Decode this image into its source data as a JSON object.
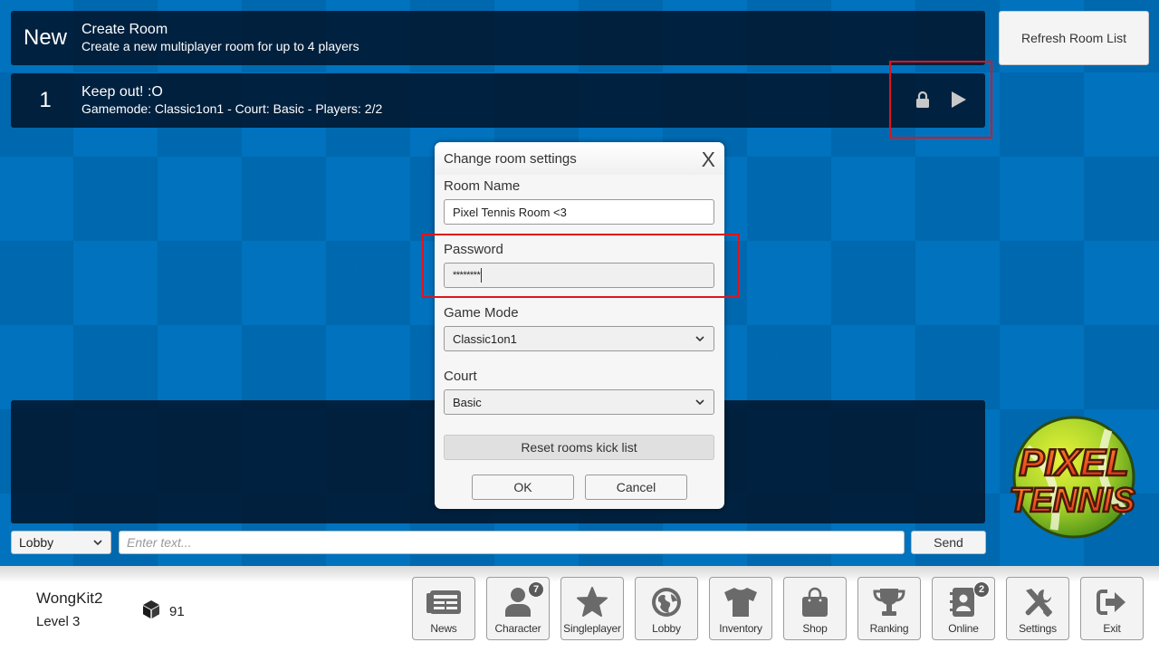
{
  "room_list": {
    "new_room": {
      "number": "New",
      "title": "Create Room",
      "subtitle": "Create a new multiplayer room for up to 4 players"
    },
    "rooms": [
      {
        "number": "1",
        "title": "Keep out! :O",
        "subtitle": "Gamemode: Classic1on1 - Court: Basic - Players: 2/2",
        "locked": true,
        "icons": [
          "lock-icon",
          "play-icon"
        ]
      }
    ],
    "refresh_label": "Refresh Room List"
  },
  "dialog": {
    "title": "Change room settings",
    "close_label": "X",
    "room_name_label": "Room Name",
    "room_name_value": "Pixel Tennis Room <3",
    "password_label": "Password",
    "password_value": "********",
    "game_mode_label": "Game Mode",
    "game_mode_value": "Classic1on1",
    "court_label": "Court",
    "court_value": "Basic",
    "reset_label": "Reset rooms kick list",
    "ok_label": "OK",
    "cancel_label": "Cancel"
  },
  "chat": {
    "channel": "Lobby",
    "placeholder": "Enter text...",
    "send_label": "Send"
  },
  "logo": {
    "line1": "PIXEL",
    "line2": "TENNIS"
  },
  "player": {
    "name": "WongKit2",
    "level": "Level 3",
    "currency_icon": "cube-icon",
    "currency": "91"
  },
  "nav": [
    {
      "label": "News",
      "icon": "newspaper-icon",
      "badge": null
    },
    {
      "label": "Character",
      "icon": "user-icon",
      "badge": "7"
    },
    {
      "label": "Singleplayer",
      "icon": "star-icon",
      "badge": null
    },
    {
      "label": "Lobby",
      "icon": "globe-icon",
      "badge": null
    },
    {
      "label": "Inventory",
      "icon": "shirt-icon",
      "badge": null
    },
    {
      "label": "Shop",
      "icon": "shopping-bag-icon",
      "badge": null
    },
    {
      "label": "Ranking",
      "icon": "trophy-icon",
      "badge": null
    },
    {
      "label": "Online",
      "icon": "contacts-icon",
      "badge": "2"
    },
    {
      "label": "Settings",
      "icon": "tools-icon",
      "badge": null
    },
    {
      "label": "Exit",
      "icon": "exit-icon",
      "badge": null
    }
  ],
  "colors": {
    "background_light": "#0072BE",
    "background_dark": "#0068AE",
    "panel": "#00162D",
    "highlight": "#E0141C",
    "icon_grey": "#6A6A6A"
  }
}
